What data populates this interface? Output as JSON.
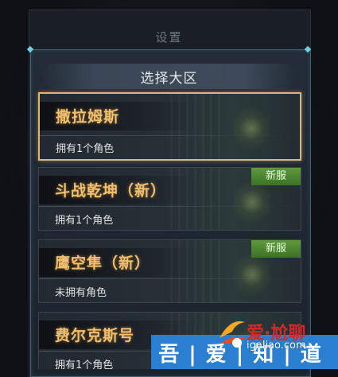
{
  "settings": {
    "title": "设置"
  },
  "server_select": {
    "title": "选择大区"
  },
  "servers": [
    {
      "name": "撒拉姆斯",
      "status": "拥有1个角色",
      "badge": ""
    },
    {
      "name": "斗战乾坤（新）",
      "status": "拥有1个角色",
      "badge": "新服"
    },
    {
      "name": "鹰空隼（新）",
      "status": "未拥有角色",
      "badge": "新服"
    },
    {
      "name": "费尔克斯号",
      "status": "拥有1个角色",
      "badge": ""
    }
  ],
  "watermark": {
    "brand": "爱·尬聊",
    "url": "igaliao.com",
    "slogan": "吾|爱|知|道"
  },
  "colors": {
    "accent_gold": "#f0c070",
    "badge_green": "#4a8530",
    "selected_border": "#d9b77c",
    "watermark_blue": "#2a7fd0"
  }
}
